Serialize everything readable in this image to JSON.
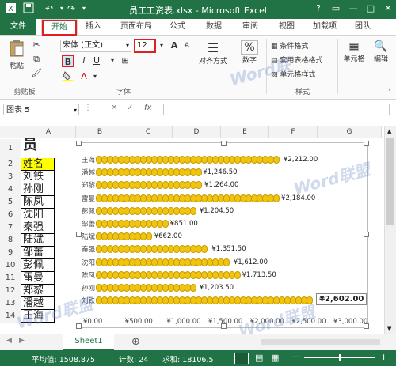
{
  "window": {
    "title": "员工工资表.xlsx - Microsoft Excel"
  },
  "qat": {
    "save_icon": "save-icon",
    "undo_icon": "undo-icon",
    "redo_icon": "redo-icon"
  },
  "window_buttons": {
    "help": "?",
    "ribbon": "▭",
    "min": "—",
    "max": "□",
    "close": "✕"
  },
  "tabs": [
    "文件",
    "开始",
    "插入",
    "页面布局",
    "公式",
    "数据",
    "审阅",
    "视图",
    "加载项",
    "团队"
  ],
  "ribbon": {
    "paste_label": "粘贴",
    "clipboard_group": "剪贴板",
    "font_name": "宋体 (正文)",
    "font_size": "12",
    "bold": "B",
    "italic": "I",
    "underline": "U",
    "font_group": "字体",
    "align_label": "对齐方式",
    "number_label": "数字",
    "percent": "%",
    "style_items": [
      "条件格式",
      "套用表格格式",
      "单元格样式"
    ],
    "style_group": "样式",
    "cells_label": "单元格",
    "edit_label": "编辑",
    "grow_font": "A",
    "shrink_font": "A",
    "font_color_letter": "A"
  },
  "formula_bar": {
    "name_box": "图表 5",
    "fx": "fx",
    "cancel": "✕",
    "enter": "✓"
  },
  "columns": [
    "A",
    "B",
    "C",
    "D",
    "E",
    "F",
    "G"
  ],
  "rows": [
    "1",
    "2",
    "3",
    "4",
    "5",
    "6",
    "7",
    "8",
    "9",
    "10",
    "11",
    "12",
    "13",
    "14"
  ],
  "cells": {
    "a1": "员",
    "names": [
      "姓名",
      "刘铁",
      "孙刚",
      "陈凤",
      "沈阳",
      "秦强",
      "陆斌",
      "邹蕾",
      "彭佩",
      "雷曼",
      "郑黎",
      "潘越",
      "王海"
    ]
  },
  "chart_data": {
    "type": "bar",
    "categories": [
      "王海",
      "潘越",
      "郑黎",
      "雷曼",
      "彭佩",
      "邹蕾",
      "陆斌",
      "秦强",
      "沈阳",
      "陈凤",
      "孙刚",
      "刘铁"
    ],
    "values": [
      2212,
      1246.5,
      1264,
      2184,
      1204.5,
      851,
      662,
      1351.5,
      1612,
      1713.5,
      1203.5,
      2602
    ],
    "data_labels": [
      "¥2,212.00",
      "¥1,246.50",
      "¥1,264.00",
      "¥2,184.00",
      "¥1,204.50",
      "¥851.00",
      "¥662.00",
      "¥1,351.50",
      "¥1,612.00",
      "¥1,713.50",
      "¥1,203.50",
      "¥2,602.00"
    ],
    "xlim": [
      0,
      3000
    ],
    "x_ticks": [
      "¥0.00",
      "¥500.00",
      "¥1,000.00",
      "¥1,500.00",
      "¥2,000.00",
      "¥2,500.00",
      "¥3,000.00"
    ],
    "selected_label": "¥2,602.00",
    "bar_color": "#f1c40f"
  },
  "sheet": {
    "tab": "Sheet1",
    "add": "⊕"
  },
  "status": {
    "average": "平均值: 1508.875",
    "count": "计数: 24",
    "sum": "求和: 18106.5",
    "zoom_minus": "—",
    "zoom_plus": "+"
  },
  "colors": {
    "excel_green": "#217346",
    "highlight_red": "#e02020",
    "header_yellow": "#ffff00"
  },
  "watermark": "Word联盟"
}
